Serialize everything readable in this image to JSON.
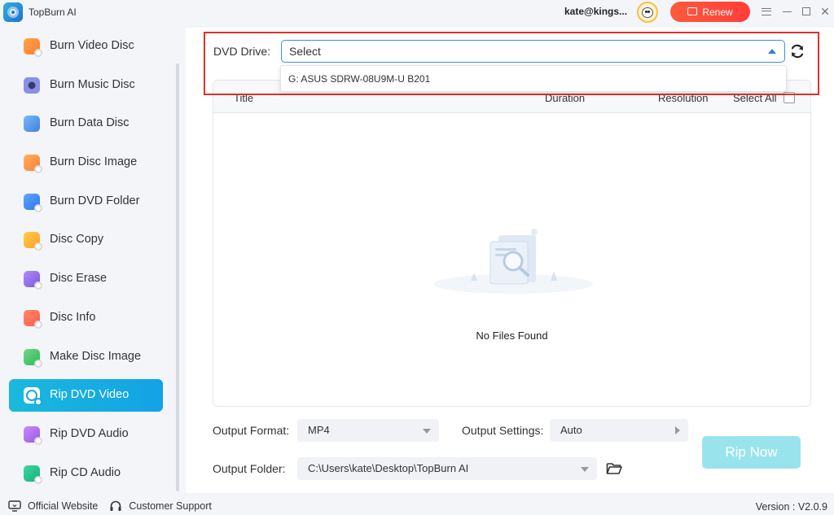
{
  "app": {
    "title": "TopBurn AI"
  },
  "header": {
    "user": "kate@kings...",
    "renew_label": "Renew"
  },
  "sidebar": {
    "items": [
      {
        "label": "Burn Video Disc",
        "icon": "burn-video-disc-icon",
        "active": false
      },
      {
        "label": "Burn Music Disc",
        "icon": "burn-music-disc-icon",
        "active": false
      },
      {
        "label": "Burn Data Disc",
        "icon": "burn-data-disc-icon",
        "active": false
      },
      {
        "label": "Burn Disc Image",
        "icon": "burn-disc-image-icon",
        "active": false
      },
      {
        "label": "Burn DVD Folder",
        "icon": "burn-dvd-folder-icon",
        "active": false
      },
      {
        "label": "Disc Copy",
        "icon": "disc-copy-icon",
        "active": false
      },
      {
        "label": "Disc Erase",
        "icon": "disc-erase-icon",
        "active": false
      },
      {
        "label": "Disc Info",
        "icon": "disc-info-icon",
        "active": false
      },
      {
        "label": "Make Disc Image",
        "icon": "make-disc-image-icon",
        "active": false
      },
      {
        "label": "Rip DVD Video",
        "icon": "rip-dvd-video-icon",
        "active": true
      },
      {
        "label": "Rip DVD Audio",
        "icon": "rip-dvd-audio-icon",
        "active": false
      },
      {
        "label": "Rip CD Audio",
        "icon": "rip-cd-audio-icon",
        "active": false
      }
    ]
  },
  "drive": {
    "label": "DVD Drive:",
    "value": "Select",
    "options": [
      "G: ASUS SDRW-08U9M-U B201"
    ]
  },
  "table": {
    "headers": {
      "title": "Title",
      "duration": "Duration",
      "resolution": "Resolution",
      "select_all": "Select All"
    },
    "empty_text": "No Files Found"
  },
  "output": {
    "format_label": "Output Format:",
    "format_value": "MP4",
    "settings_label": "Output Settings:",
    "settings_value": "Auto",
    "folder_label": "Output Folder:",
    "folder_value": "C:\\Users\\kate\\Desktop\\TopBurn AI",
    "rip_label": "Rip Now"
  },
  "footer": {
    "website": "Official Website",
    "support": "Customer Support",
    "version": "Version : V2.0.9"
  },
  "colors": {
    "accent": "#14a2e6",
    "renew": "#ff4a3a",
    "highlight_border": "#e0302b",
    "rip_button": "#99e4ec"
  }
}
